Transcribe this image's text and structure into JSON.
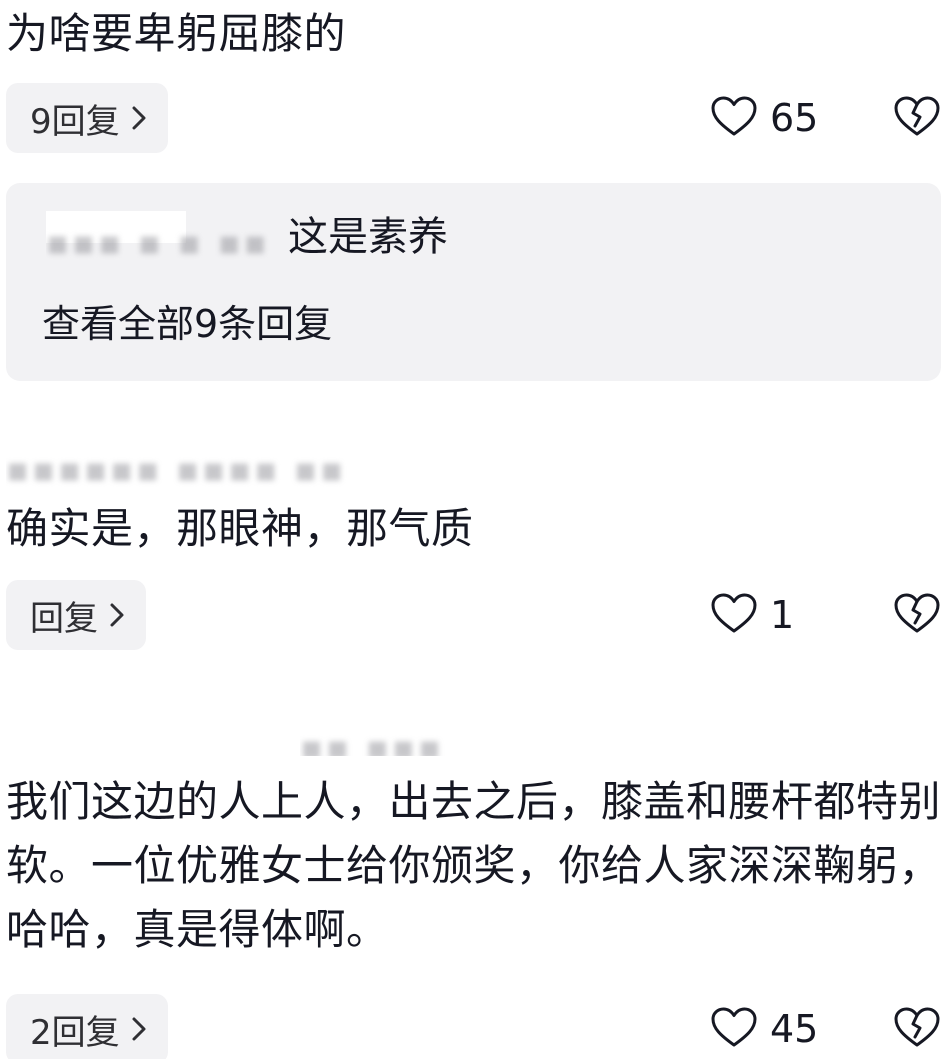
{
  "comments": [
    {
      "text": "为啥要卑躬屈膝的",
      "reply_label": "9回复",
      "likes": "65"
    },
    {
      "author": "",
      "text": "确实是，那眼神，那气质",
      "reply_label": "回复",
      "likes": "1"
    },
    {
      "author": "",
      "text": "我们这边的人上人，出去之后，膝盖和腰杆都特别软。一位优雅女士给你颁奖，你给人家深深鞠躬，哈哈，真是得体啊。",
      "reply_label": "2回复",
      "likes": "45"
    }
  ],
  "sub_reply": {
    "text": "这是素养",
    "view_all_label": "查看全部9条回复"
  },
  "icons": {
    "like": "heart-outline-icon",
    "dislike": "broken-heart-icon",
    "chevron": "chevron-right-icon"
  },
  "colors": {
    "text": "#161823",
    "chip_bg": "#f2f2f4"
  }
}
